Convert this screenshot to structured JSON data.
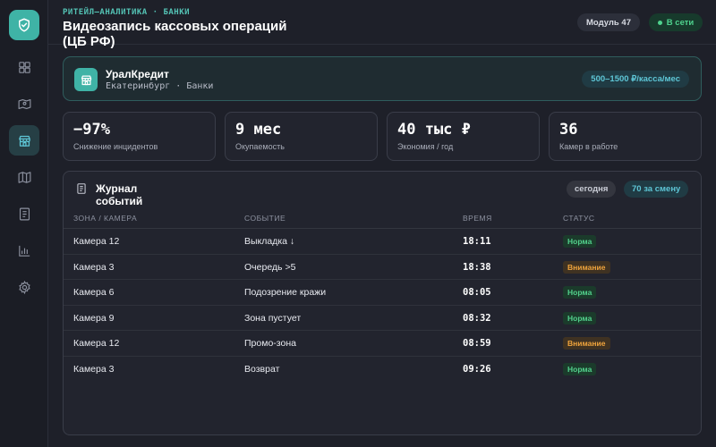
{
  "header": {
    "kicker": "РИТЕЙЛ—АНАЛИТИКА · БАНКИ",
    "title": "Видеозапись кассовых операций (ЦБ РФ)",
    "module_label": "Модуль 47",
    "online_label": "В сети"
  },
  "sidebar": {
    "items": [
      {
        "icon": "dashboard-icon",
        "active": false
      },
      {
        "icon": "map-route-icon",
        "active": false
      },
      {
        "icon": "store-icon",
        "active": true
      },
      {
        "icon": "map-icon",
        "active": false
      },
      {
        "icon": "document-icon",
        "active": false
      },
      {
        "icon": "bar-chart-icon",
        "active": false
      },
      {
        "icon": "gear-icon",
        "active": false
      }
    ]
  },
  "company": {
    "name": "УралКредит",
    "city": "Екатеринбург",
    "sector": "Банки",
    "price": "500–1500 ₽/касса/мес"
  },
  "kpis": [
    {
      "value": "−97%",
      "label": "Снижение инцидентов"
    },
    {
      "value": "9 мес",
      "label": "Окупаемость"
    },
    {
      "value": "40 тыс ₽",
      "label": "Экономия / год"
    },
    {
      "value": "36",
      "label": "Камер в работе"
    }
  ],
  "journal": {
    "title": "Журнал событий",
    "chip_today": "сегодня",
    "chip_shift": "70 за смену",
    "columns": [
      "ЗОНА / КАМЕРА",
      "СОБЫТИЕ",
      "ВРЕМЯ",
      "СТАТУС"
    ],
    "rows": [
      {
        "zone": "Камера 12",
        "event": "Выкладка ↓",
        "time": "18:11",
        "status": "Норма",
        "kind": "ok"
      },
      {
        "zone": "Камера 3",
        "event": "Очередь >5",
        "time": "18:38",
        "status": "Внимание",
        "kind": "warn"
      },
      {
        "zone": "Камера 6",
        "event": "Подозрение кражи",
        "time": "08:05",
        "status": "Норма",
        "kind": "ok"
      },
      {
        "zone": "Камера 9",
        "event": "Зона пустует",
        "time": "08:32",
        "status": "Норма",
        "kind": "ok"
      },
      {
        "zone": "Камера 12",
        "event": "Промо-зона",
        "time": "08:59",
        "status": "Внимание",
        "kind": "warn"
      },
      {
        "zone": "Камера 3",
        "event": "Возврат",
        "time": "09:26",
        "status": "Норма",
        "kind": "ok"
      }
    ]
  },
  "colors": {
    "accent": "#3fb3a6",
    "ok": "#52d18c",
    "warn": "#f0a43c",
    "background": "#1e2029"
  }
}
